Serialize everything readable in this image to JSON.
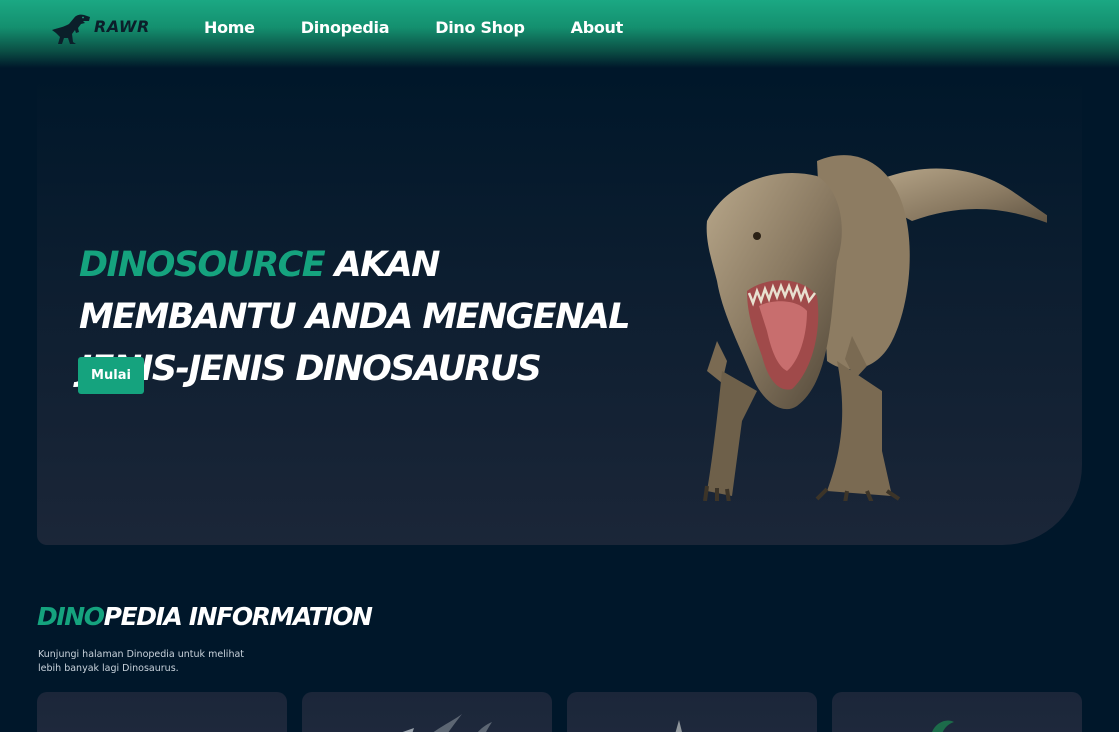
{
  "navbar": {
    "logo_text": "RAWR",
    "links": [
      "Home",
      "Dinopedia",
      "Dino Shop",
      "About"
    ]
  },
  "hero": {
    "title_accent": "DINOSOURCE",
    "title_rest": " AKAN MEMBANTU ANDA MENGENAL JENIS-JENIS DINOSAURUS",
    "button_label": "Mulai"
  },
  "section": {
    "title_accent": "DINO",
    "title_rest": "PEDIA INFORMATION",
    "description": "Kunjungi halaman Dinopedia untuk melihat lebih banyak lagi Dinosaurus."
  },
  "colors": {
    "accent": "#15a37e",
    "background": "#00172a",
    "hero_panel": "#1b2638"
  },
  "cards": [
    {
      "icon": "dino-head-icon"
    },
    {
      "icon": "triceratops-horns-icon"
    },
    {
      "icon": "dino-spike-icon"
    },
    {
      "icon": "green-dino-icon"
    }
  ]
}
